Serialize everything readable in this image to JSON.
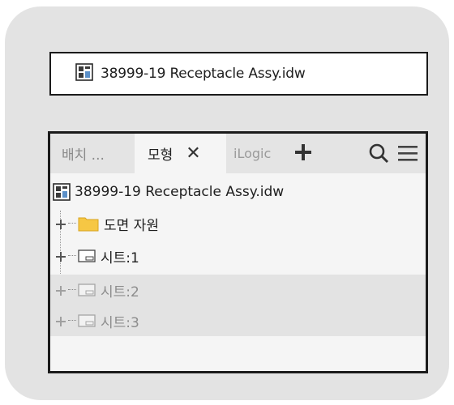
{
  "title_bar": {
    "document_name": "38999-19 Receptacle Assy.idw"
  },
  "browser": {
    "tabs": [
      {
        "label": "배치 ...",
        "active": false
      },
      {
        "label": "모형",
        "active": true,
        "close_glyph": "✕"
      },
      {
        "label": "iLogic",
        "active": false
      }
    ],
    "tree": {
      "root_label": "38999-19 Receptacle Assy.idw",
      "items": [
        {
          "label": "도면 자원",
          "icon": "folder-icon",
          "dimmed": false
        },
        {
          "label": "시트:1",
          "icon": "sheet-icon",
          "dimmed": false
        },
        {
          "label": "시트:2",
          "icon": "sheet-icon",
          "dimmed": true
        },
        {
          "label": "시트:3",
          "icon": "sheet-icon",
          "dimmed": true
        }
      ]
    }
  },
  "colors": {
    "outer_background": "#e3e3e3",
    "panel_background": "#f5f5f5",
    "folder_yellow": "#f6c744",
    "dimmed_row": "#e3e3e3"
  }
}
